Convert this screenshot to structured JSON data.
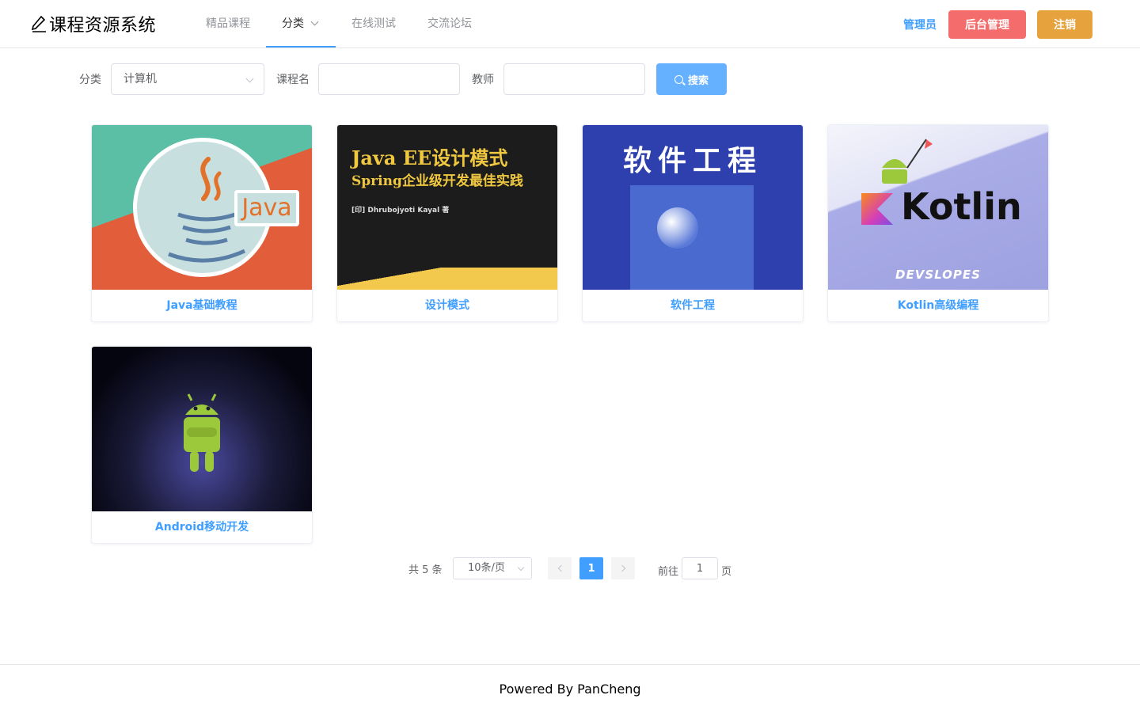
{
  "header": {
    "logo_text": "课程资源系统",
    "nav": [
      {
        "label": "精品课程"
      },
      {
        "label": "分类"
      },
      {
        "label": "在线测试"
      },
      {
        "label": "交流论坛"
      }
    ],
    "admin_label": "管理员",
    "backend_button": "后台管理",
    "logout_button": "注销"
  },
  "search": {
    "category_label": "分类",
    "category_value": "计算机",
    "course_name_label": "课程名",
    "course_name_value": "",
    "teacher_label": "教师",
    "teacher_value": "",
    "search_button": "搜索"
  },
  "courses": [
    {
      "title": "Java基础教程",
      "image_text": "Java"
    },
    {
      "title": "设计模式",
      "image_text_1": "Java EE设计模式",
      "image_text_2": "Spring企业级开发最佳实践",
      "image_text_3": "[印] Dhrubojyoti Kayal 著"
    },
    {
      "title": "软件工程",
      "image_text": "软件工程"
    },
    {
      "title": "Kotlin高级编程",
      "image_text": "Kotlin",
      "image_text_2": "DEVSLOPES"
    },
    {
      "title": "Android移动开发"
    }
  ],
  "pagination": {
    "total_text": "共 5 条",
    "page_size": "10条/页",
    "current_page": "1",
    "goto_label": "前往",
    "goto_value": "1",
    "page_suffix": "页"
  },
  "footer": {
    "text": "Powered By PanCheng"
  },
  "colors": {
    "primary": "#409eff",
    "danger": "#f56c6c",
    "warning": "#e6a23c"
  }
}
